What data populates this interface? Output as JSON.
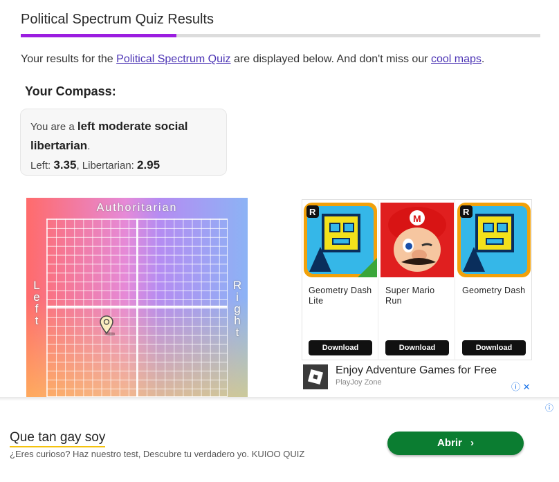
{
  "header": {
    "title": "Political Spectrum Quiz Results",
    "progress_fraction": 0.3
  },
  "intro": {
    "prefix": "Your results for the ",
    "quiz_link": "Political Spectrum Quiz",
    "middle": " are displayed below. And don't miss our ",
    "maps_link": "cool maps",
    "suffix": "."
  },
  "compass_section": {
    "heading": "Your Compass:",
    "you_are": "You are a ",
    "result": "left moderate social libertarian",
    "period": ".",
    "left_label": "Left: ",
    "left_value": "3.35",
    "lib_label": ", Libertarian: ",
    "lib_value": "2.95"
  },
  "compass": {
    "top_label": "Authoritarian",
    "left_label": "Left",
    "right_label": "Right",
    "marker_icon": "map-pin-icon"
  },
  "ads": {
    "apps": [
      {
        "name": "Geometry Dash Lite",
        "button": "Download",
        "icon": "geometry-dash-lite-icon"
      },
      {
        "name": "Super Mario Run",
        "button": "Download",
        "icon": "super-mario-run-icon"
      },
      {
        "name": "Geometry Dash",
        "button": "Download",
        "icon": "geometry-dash-icon"
      }
    ],
    "promo": {
      "title": "Enjoy Adventure Games for Free",
      "subtitle": "PlayJoy Zone",
      "icons": "ⓘ ✕"
    }
  },
  "bottom_ad": {
    "title": "Que tan gay soy",
    "description": "¿Eres curioso? Haz nuestro test, Descubre tu verdadero yo. KUIOO QUIZ",
    "button": "Abrir",
    "info_icon": "ⓘ"
  },
  "colors": {
    "accent": "#9b1de0",
    "link": "#4b33b4",
    "cta_green": "#0b7d31"
  }
}
